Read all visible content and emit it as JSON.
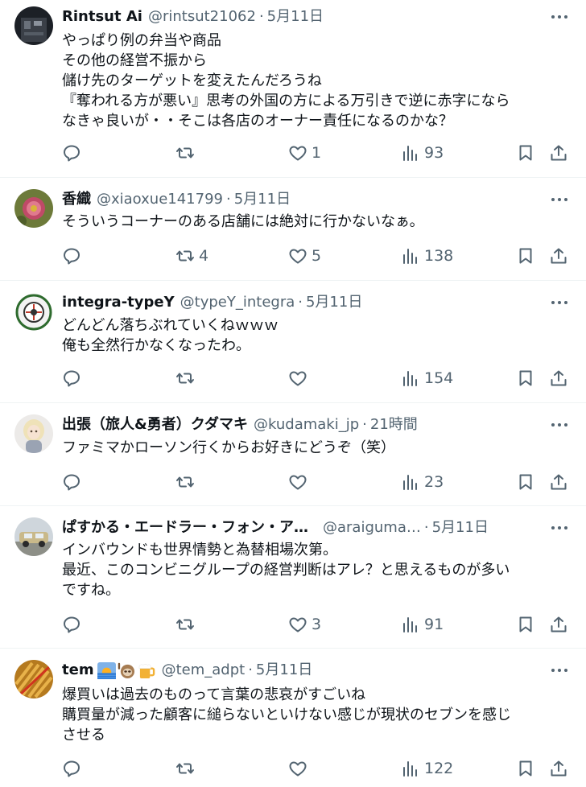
{
  "colors": {
    "text": "#0f1419",
    "secondary": "#536471",
    "divider": "#eff3f4",
    "background": "#ffffff"
  },
  "icons": {
    "reply": "speech-bubble",
    "retweet": "two-arrows-loop",
    "like": "heart",
    "views": "bar-chart",
    "bookmark": "bookmark",
    "share": "upload-arrow",
    "more": "three-dots"
  },
  "tweets": [
    {
      "author": "Rintsut Ai",
      "handle": "@rintsut21062",
      "sep": "·",
      "time": "5月11日",
      "lines": [
        "やっぱり例の弁当や商品",
        "その他の経営不振から",
        "儲け先のターゲットを変えたんだろうね",
        "『奪われる方が悪い』思考の外国の方による万引きで逆に赤字になら",
        "なきゃ良いが・・そこは各店のオーナー責任になるのかな？"
      ],
      "replies": "",
      "retweets": "",
      "likes": "1",
      "views": "93"
    },
    {
      "author": "香織",
      "handle": "@xiaoxue141799",
      "sep": "·",
      "time": "5月11日",
      "lines": [
        "そういうコーナーのある店舗には絶対に行かないなぁ。"
      ],
      "replies": "",
      "retweets": "4",
      "likes": "5",
      "views": "138"
    },
    {
      "author": "integra-typeY",
      "handle": "@typeY_integra",
      "sep": "·",
      "time": "5月11日",
      "lines": [
        "どんどん落ちぶれていくねｗｗｗ",
        "俺も全然行かなくなったわ。"
      ],
      "replies": "",
      "retweets": "",
      "likes": "",
      "views": "154"
    },
    {
      "author": "出張（旅人&勇者）クダマキ",
      "handle": "@kudamaki_jp",
      "sep": "·",
      "time": "21時間",
      "lines": [
        "ファミマかローソン行くからお好きにどうぞ（笑）"
      ],
      "replies": "",
      "retweets": "",
      "likes": "",
      "views": "23"
    },
    {
      "author": "ぱすかる・エードラー・フォン・ア…",
      "handle": "@araiguma…",
      "sep": "·",
      "time": "5月11日",
      "lines": [
        "インバウンドも世界情勢と為替相場次第。",
        "最近、このコンビニグループの経営判断はアレ？と思えるものが多い",
        "ですね。"
      ],
      "replies": "",
      "retweets": "",
      "likes": "3",
      "views": "91"
    },
    {
      "author": "tem",
      "author_emoji": [
        "sunrise",
        "sloth",
        "beer"
      ],
      "handle": "@tem_adpt",
      "sep": "·",
      "time": "5月11日",
      "lines": [
        "爆買いは過去のものって言葉の悲哀がすごいね",
        "購買量が減った顧客に縋らないといけない感じが現状のセブンを感じ",
        "させる"
      ],
      "replies": "",
      "retweets": "",
      "likes": "",
      "views": "122"
    }
  ]
}
